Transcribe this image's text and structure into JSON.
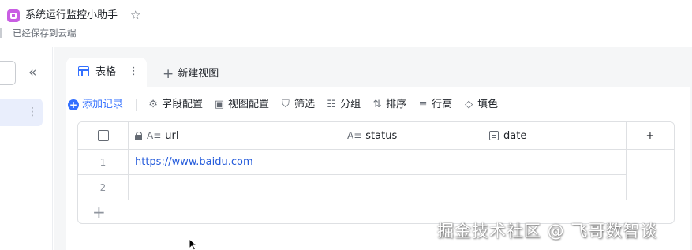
{
  "app": {
    "title": "系统运行监控小助手",
    "save_status": "已经保存到云端",
    "icon_color": "#c95ee3"
  },
  "views": {
    "active_tab": "表格",
    "new_view_label": "新建视图"
  },
  "toolbar": {
    "add_record": "添加记录",
    "field_config": "字段配置",
    "view_config": "视图配置",
    "filter": "筛选",
    "group": "分组",
    "sort": "排序",
    "row_height": "行高",
    "fill": "填色"
  },
  "table": {
    "columns": [
      {
        "label": "url",
        "icon": "text-field-icon",
        "locked": true
      },
      {
        "label": "status",
        "icon": "text-field-icon"
      },
      {
        "label": "date",
        "icon": "date-field-icon"
      }
    ],
    "rows": [
      {
        "index": "1",
        "url": "https://www.baidu.com",
        "status": "",
        "date": ""
      },
      {
        "index": "2",
        "url": "",
        "status": "",
        "date": ""
      }
    ]
  },
  "watermark": "掘金技术社区 @ 飞哥数智谈",
  "colors": {
    "accent": "#3370ff",
    "link": "#245bdb"
  }
}
